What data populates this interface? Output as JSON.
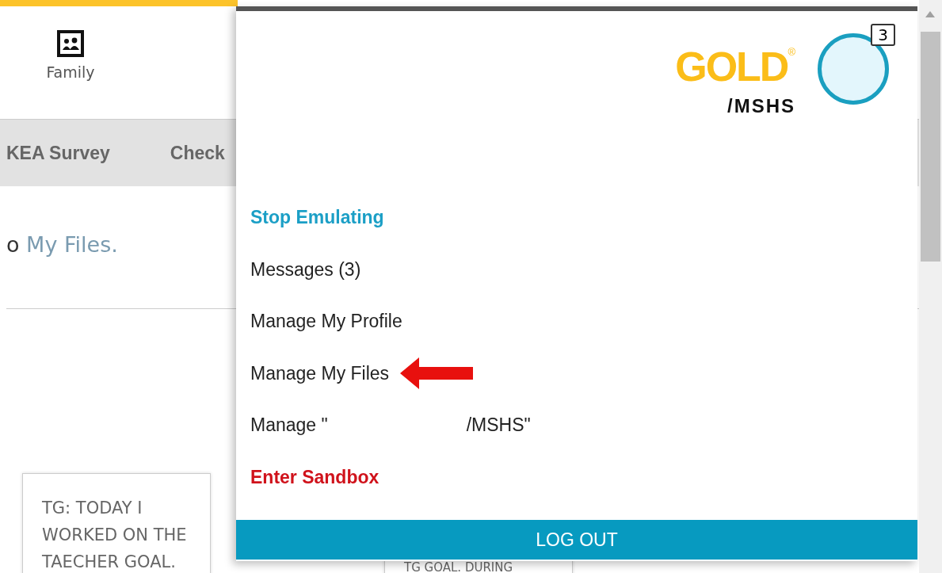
{
  "page": {
    "nav_icon_label": "Family",
    "tabs": [
      {
        "label": "KEA Survey"
      },
      {
        "label": "Check"
      }
    ],
    "message": {
      "before": "o",
      "link": "My Files."
    },
    "cards": [
      {
        "text": "TG: TODAY I WORKED ON THE TAECHER GOAL."
      },
      {
        "text": "TG GOAL. DURING"
      }
    ]
  },
  "menu": {
    "logo": {
      "text": "GOLD",
      "mark": "®"
    },
    "org": "/MSHS",
    "badge": "3",
    "items": [
      {
        "kind": "emulate",
        "label": "Stop Emulating",
        "pointed": false
      },
      {
        "kind": "plain",
        "label": "Messages (3)",
        "pointed": false
      },
      {
        "kind": "plain",
        "label": "Manage My Profile",
        "pointed": false
      },
      {
        "kind": "plain",
        "label": "Manage My Files",
        "pointed": true
      },
      {
        "kind": "redacted",
        "label": "Manage \"",
        "label_end": "/MSHS\"",
        "pointed": false
      },
      {
        "kind": "sandbox",
        "label": "Enter Sandbox",
        "pointed": false
      }
    ],
    "logout": "LOG OUT"
  }
}
